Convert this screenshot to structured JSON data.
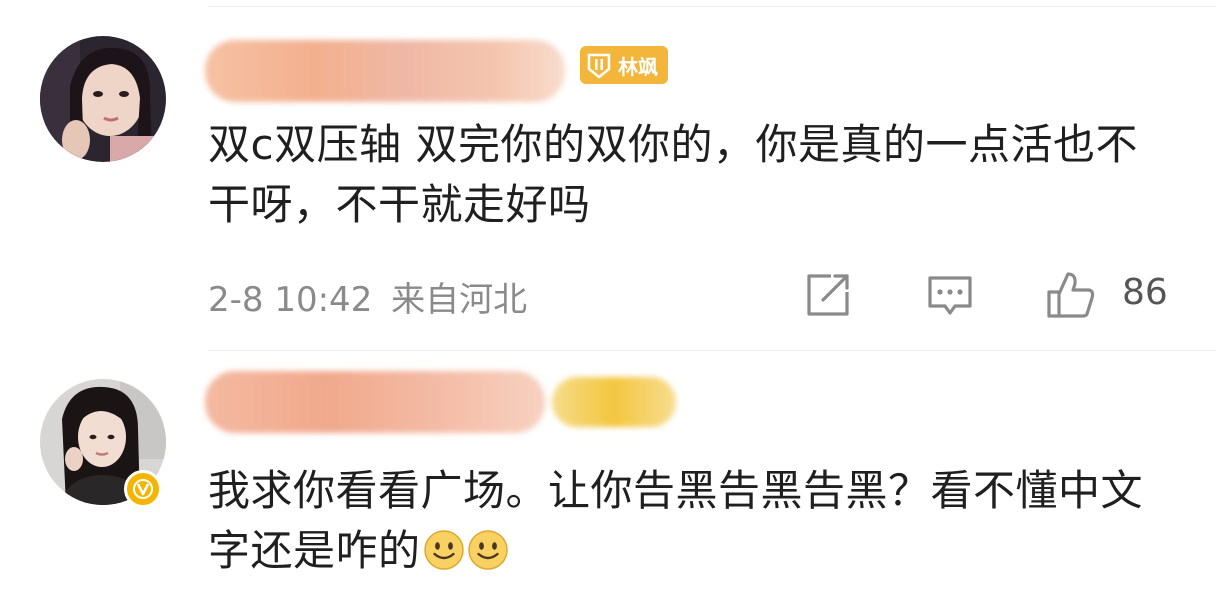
{
  "comments": [
    {
      "level_badge": "林飒",
      "text": "双c双压轴 双完你的双你的，你是真的一点活也不干呀，不干就走好吗",
      "date": "2-8 10:42",
      "location": "来自河北",
      "like_count": "86"
    },
    {
      "text": "我求你看看广场。让你告黑告黑告黑？看不懂中文字还是咋的"
    }
  ],
  "icons": {
    "share": "share-icon",
    "reply": "comment-icon",
    "like": "thumb-up-icon",
    "emoji": "smiley-emoji-icon",
    "verified": "verified-v-icon",
    "level": "level-1-badge-icon"
  },
  "colors": {
    "badge": "#f4b53b",
    "verified": "#f5b400",
    "meta_text": "#8a8a8a",
    "body_text": "#1f1f1f"
  }
}
